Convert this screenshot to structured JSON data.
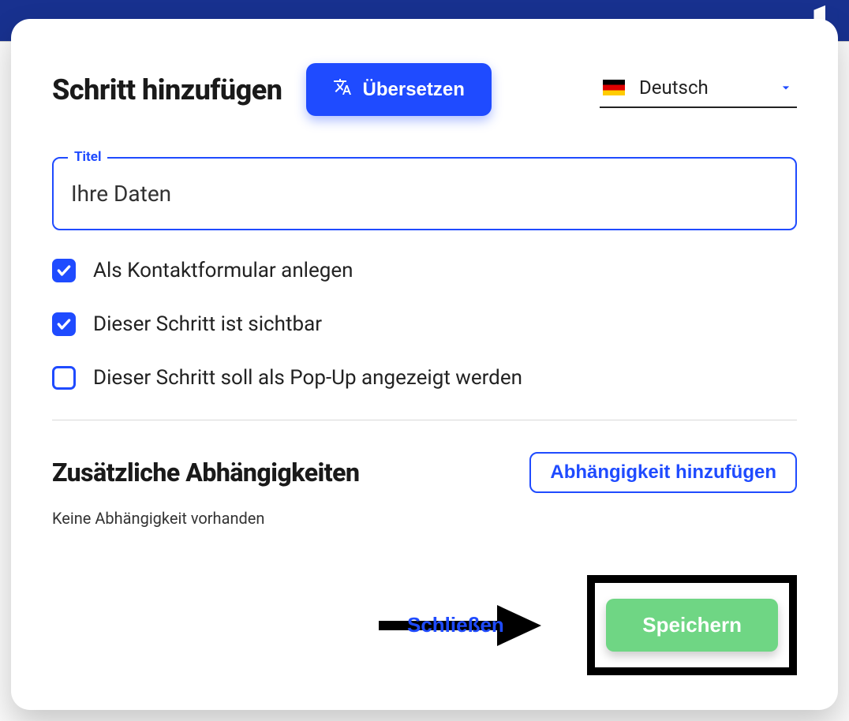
{
  "modal": {
    "title": "Schritt hinzufügen",
    "translate_label": "Übersetzen",
    "language": {
      "label": "Deutsch"
    },
    "field": {
      "legend": "Titel",
      "value": "Ihre Daten"
    },
    "checks": [
      {
        "label": "Als Kontaktformular anlegen",
        "checked": true
      },
      {
        "label": "Dieser Schritt ist sichtbar",
        "checked": true
      },
      {
        "label": "Dieser Schritt soll als Pop-Up angezeigt werden",
        "checked": false
      }
    ],
    "deps": {
      "title": "Zusätzliche Abhängigkeiten",
      "add_label": "Abhängigkeit hinzufügen",
      "empty_text": "Keine Abhängigkeit vorhanden"
    },
    "footer": {
      "close_label": "Schließen",
      "save_label": "Speichern"
    }
  }
}
